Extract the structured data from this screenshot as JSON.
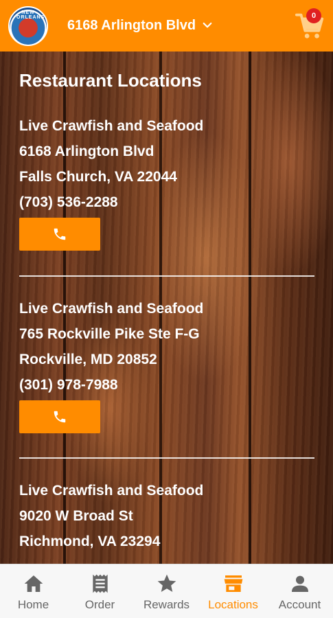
{
  "header": {
    "selected_location": "6168 Arlington Blvd",
    "cart_count": "0",
    "logo_text": "NEW ORLEANS"
  },
  "page": {
    "title": "Restaurant Locations"
  },
  "locations": [
    {
      "name": "Live Crawfish and Seafood",
      "street": "6168 Arlington Blvd",
      "city_state_zip": "Falls Church, VA 22044",
      "phone": "(703) 536-2288"
    },
    {
      "name": "Live Crawfish and Seafood",
      "street": "765 Rockville Pike Ste F-G",
      "city_state_zip": "Rockville, MD 20852",
      "phone": "(301) 978-7988"
    },
    {
      "name": "Live Crawfish and Seafood",
      "street": "9020 W Broad St",
      "city_state_zip": "Richmond, VA 23294"
    }
  ],
  "nav": {
    "items": [
      {
        "label": "Home",
        "icon": "home-icon"
      },
      {
        "label": "Order",
        "icon": "receipt-icon"
      },
      {
        "label": "Rewards",
        "icon": "star-icon"
      },
      {
        "label": "Locations",
        "icon": "store-icon",
        "active": true
      },
      {
        "label": "Account",
        "icon": "person-icon"
      }
    ]
  },
  "colors": {
    "accent": "#ff8c00",
    "badge": "#e02020",
    "nav_inactive": "#666666"
  }
}
